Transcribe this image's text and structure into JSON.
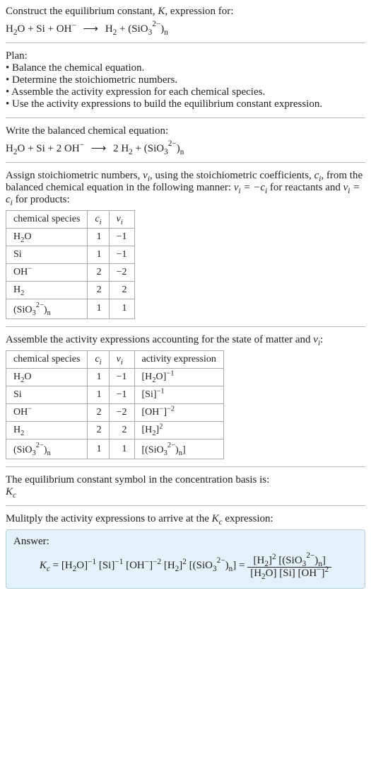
{
  "title_line1": "Construct the equilibrium constant, ",
  "title_K": "K",
  "title_line1b": ", expression for:",
  "unbalanced": {
    "lhs": [
      "H₂O",
      "Si",
      "OH⁻"
    ],
    "rhs": [
      "H₂",
      "(SiO₃²⁻)ₙ"
    ],
    "plus": " + ",
    "arrow": "⟶"
  },
  "plan_label": "Plan:",
  "plan_items": [
    "• Balance the chemical equation.",
    "• Determine the stoichiometric numbers.",
    "• Assemble the activity expression for each chemical species.",
    "• Use the activity expressions to build the equilibrium constant expression."
  ],
  "balanced_label": "Write the balanced chemical equation:",
  "balanced": {
    "lhs": [
      "H₂O",
      "Si",
      "2 OH⁻"
    ],
    "rhs": [
      "2 H₂",
      "(SiO₃²⁻)ₙ"
    ],
    "plus": " + ",
    "arrow": "⟶"
  },
  "assign_text_a": "Assign stoichiometric numbers, ",
  "assign_nu": "νᵢ",
  "assign_text_b": ", using the stoichiometric coefficients, ",
  "assign_c": "cᵢ",
  "assign_text_c": ", from the balanced chemical equation in the following manner: ",
  "assign_eq1": "νᵢ = −cᵢ",
  "assign_text_d": " for reactants and ",
  "assign_eq2": "νᵢ = cᵢ",
  "assign_text_e": " for products:",
  "table1": {
    "headers": [
      "chemical species",
      "cᵢ",
      "νᵢ"
    ],
    "rows": [
      [
        "H₂O",
        "1",
        "−1"
      ],
      [
        "Si",
        "1",
        "−1"
      ],
      [
        "OH⁻",
        "2",
        "−2"
      ],
      [
        "H₂",
        "2",
        "2"
      ],
      [
        "(SiO₃²⁻)ₙ",
        "1",
        "1"
      ]
    ]
  },
  "assemble_text_a": "Assemble the activity expressions accounting for the state of matter and ",
  "assemble_nu": "νᵢ",
  "assemble_text_b": ":",
  "table2": {
    "headers": [
      "chemical species",
      "cᵢ",
      "νᵢ",
      "activity expression"
    ],
    "rows": [
      {
        "sp": "H₂O",
        "c": "1",
        "v": "−1",
        "act_base": "[H₂O]",
        "act_exp": "−1"
      },
      {
        "sp": "Si",
        "c": "1",
        "v": "−1",
        "act_base": "[Si]",
        "act_exp": "−1"
      },
      {
        "sp": "OH⁻",
        "c": "2",
        "v": "−2",
        "act_base": "[OH⁻]",
        "act_exp": "−2"
      },
      {
        "sp": "H₂",
        "c": "2",
        "v": "2",
        "act_base": "[H₂]",
        "act_exp": "2"
      },
      {
        "sp": "(SiO₃²⁻)ₙ",
        "c": "1",
        "v": "1",
        "act_base": "[(SiO₃²⁻)ₙ]",
        "act_exp": ""
      }
    ]
  },
  "kc_line1": "The equilibrium constant symbol in the concentration basis is:",
  "kc_sym_K": "K",
  "kc_sym_c": "c",
  "multiply_a": "Mulitply the activity expressions to arrive at the ",
  "multiply_b": " expression:",
  "answer_label": "Answer:",
  "answer": {
    "Kc_eq": "Kc = ",
    "flat_terms": [
      {
        "base": "[H₂O]",
        "exp": "−1"
      },
      {
        "base": "[Si]",
        "exp": "−1"
      },
      {
        "base": "[OH⁻]",
        "exp": "−2"
      },
      {
        "base": "[H₂]",
        "exp": "2"
      },
      {
        "base": "[(SiO₃²⁻)ₙ]",
        "exp": ""
      }
    ],
    "eq": " = ",
    "num": [
      {
        "base": "[H₂]",
        "exp": "2"
      },
      {
        "base": "[(SiO₃²⁻)ₙ]",
        "exp": ""
      }
    ],
    "den": [
      {
        "base": "[H₂O]",
        "exp": ""
      },
      {
        "base": "[Si]",
        "exp": ""
      },
      {
        "base": "[OH⁻]",
        "exp": "2"
      }
    ]
  },
  "chart_data": {
    "type": "table",
    "title": "Equilibrium constant derivation for H₂O + Si + 2 OH⁻ ⟶ 2 H₂ + (SiO₃²⁻)ₙ",
    "stoichiometry": [
      {
        "species": "H2O",
        "c_i": 1,
        "nu_i": -1,
        "activity": "[H2O]^-1"
      },
      {
        "species": "Si",
        "c_i": 1,
        "nu_i": -1,
        "activity": "[Si]^-1"
      },
      {
        "species": "OH-",
        "c_i": 2,
        "nu_i": -2,
        "activity": "[OH-]^-2"
      },
      {
        "species": "H2",
        "c_i": 2,
        "nu_i": 2,
        "activity": "[H2]^2"
      },
      {
        "species": "(SiO3^2-)_n",
        "c_i": 1,
        "nu_i": 1,
        "activity": "[(SiO3^2-)_n]"
      }
    ],
    "Kc": "[H2]^2 [(SiO3^2-)_n] / ( [H2O] [Si] [OH-]^2 )"
  }
}
